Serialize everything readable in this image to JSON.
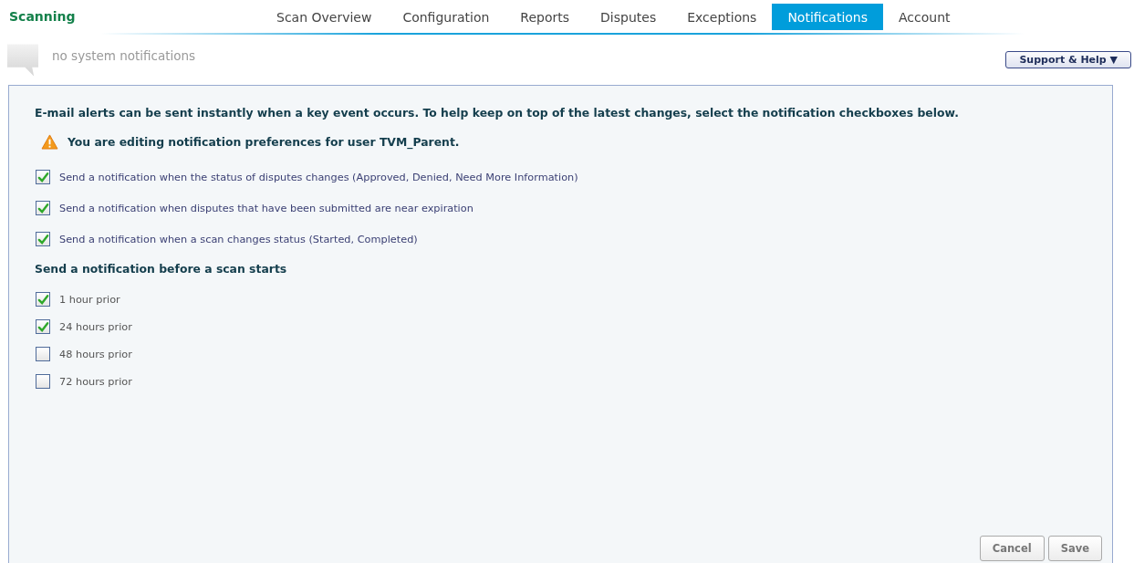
{
  "app": {
    "title": "Scanning"
  },
  "tabs": [
    {
      "label": "Scan Overview",
      "selected": false
    },
    {
      "label": "Configuration",
      "selected": false
    },
    {
      "label": "Reports",
      "selected": false
    },
    {
      "label": "Disputes",
      "selected": false
    },
    {
      "label": "Exceptions",
      "selected": false
    },
    {
      "label": "Notifications",
      "selected": true
    },
    {
      "label": "Account",
      "selected": false
    }
  ],
  "system_notifications": {
    "text": "no system notifications"
  },
  "support_button": {
    "label": "Support & Help",
    "caret": "▼"
  },
  "panel": {
    "intro": "E-mail alerts can be sent instantly when a key event occurs. To help keep on top of the latest changes, select the notification checkboxes below.",
    "warning": "You are editing notification preferences for user TVM_Parent.",
    "options": [
      {
        "label": "Send a notification when the status of disputes changes (Approved, Denied, Need More Information)",
        "checked": true
      },
      {
        "label": "Send a notification when disputes that have been submitted are near expiration",
        "checked": true
      },
      {
        "label": "Send a notification when a scan changes status (Started, Completed)",
        "checked": true
      }
    ],
    "before_scan_heading": "Send a notification before a scan starts",
    "before_scan_options": [
      {
        "label": "1 hour prior",
        "checked": true
      },
      {
        "label": "24 hours prior",
        "checked": true
      },
      {
        "label": "48 hours prior",
        "checked": false
      },
      {
        "label": "72 hours prior",
        "checked": false
      }
    ],
    "buttons": [
      {
        "label": "Cancel"
      },
      {
        "label": "Save"
      }
    ]
  }
}
